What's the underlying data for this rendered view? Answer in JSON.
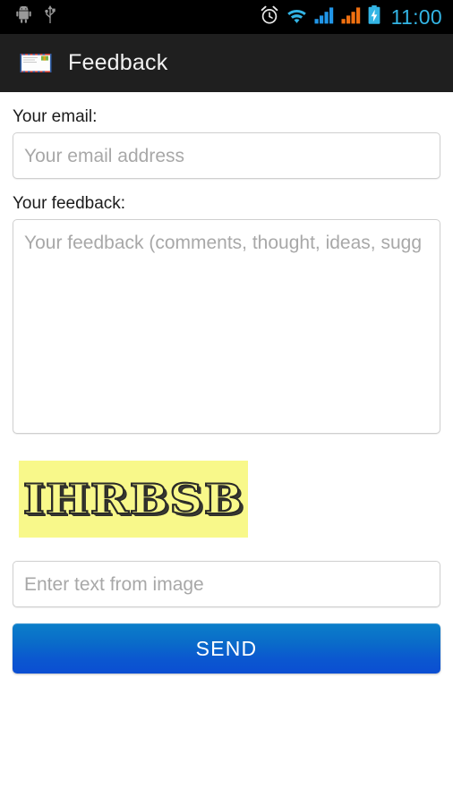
{
  "status_bar": {
    "time": "11:00",
    "accent_color": "#33b5e5",
    "background": "#000000",
    "left_icons": [
      {
        "name": "android-debug-icon",
        "label": "Android debugging"
      },
      {
        "name": "usb-icon",
        "label": "USB connected"
      }
    ],
    "right_icons": [
      {
        "name": "alarm-icon",
        "label": "Alarm set"
      },
      {
        "name": "wifi-icon",
        "label": "Wi-Fi signal"
      },
      {
        "name": "signal-sim1-icon",
        "label": "Cellular signal SIM 1"
      },
      {
        "name": "signal-sim2-icon",
        "label": "Cellular signal SIM 2"
      },
      {
        "name": "battery-charging-icon",
        "label": "Battery charging"
      }
    ]
  },
  "action_bar": {
    "title": "Feedback",
    "icon": "airmail-envelope-icon",
    "background": "#1f1f1f"
  },
  "form": {
    "email": {
      "label": "Your email:",
      "placeholder": "Your email address",
      "value": ""
    },
    "feedback": {
      "label": "Your feedback:",
      "placeholder": "Your feedback (comments, thought, ideas, sugg",
      "value": ""
    },
    "captcha": {
      "image_text": "IHRBSB",
      "image_background": "#f8f88a",
      "input_placeholder": "Enter text from image",
      "input_value": ""
    },
    "submit": {
      "label": "SEND",
      "gradient_top": "#0b7fc9",
      "gradient_bottom": "#0b4ed2"
    }
  }
}
